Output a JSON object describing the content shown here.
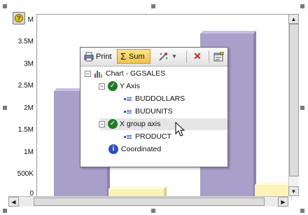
{
  "help_button": {
    "label": "?"
  },
  "y_axis_ticks": [
    "M",
    "3.5M",
    "3M",
    "2.5M",
    "2M",
    "1.5M",
    "1M",
    "500K",
    "0"
  ],
  "colors": {
    "bar_purple": "#a89fcb",
    "bar_yellow": "#fdf3b8",
    "accent": "#f2c24e"
  },
  "popup": {
    "toolbar": {
      "print_label": "Print",
      "sum_label": "Sum",
      "sum_glyph": "Σ",
      "delete_glyph": "✕"
    },
    "tree": {
      "root_label": "Chart - GGSALES",
      "y_axis_label": "Y Axis",
      "y_items": [
        "BUDDOLLARS",
        "BUDUNITS"
      ],
      "x_axis_label": "X group axis",
      "x_items": [
        "PRODUCT"
      ],
      "coordinated_label": "Coordinated"
    }
  }
}
